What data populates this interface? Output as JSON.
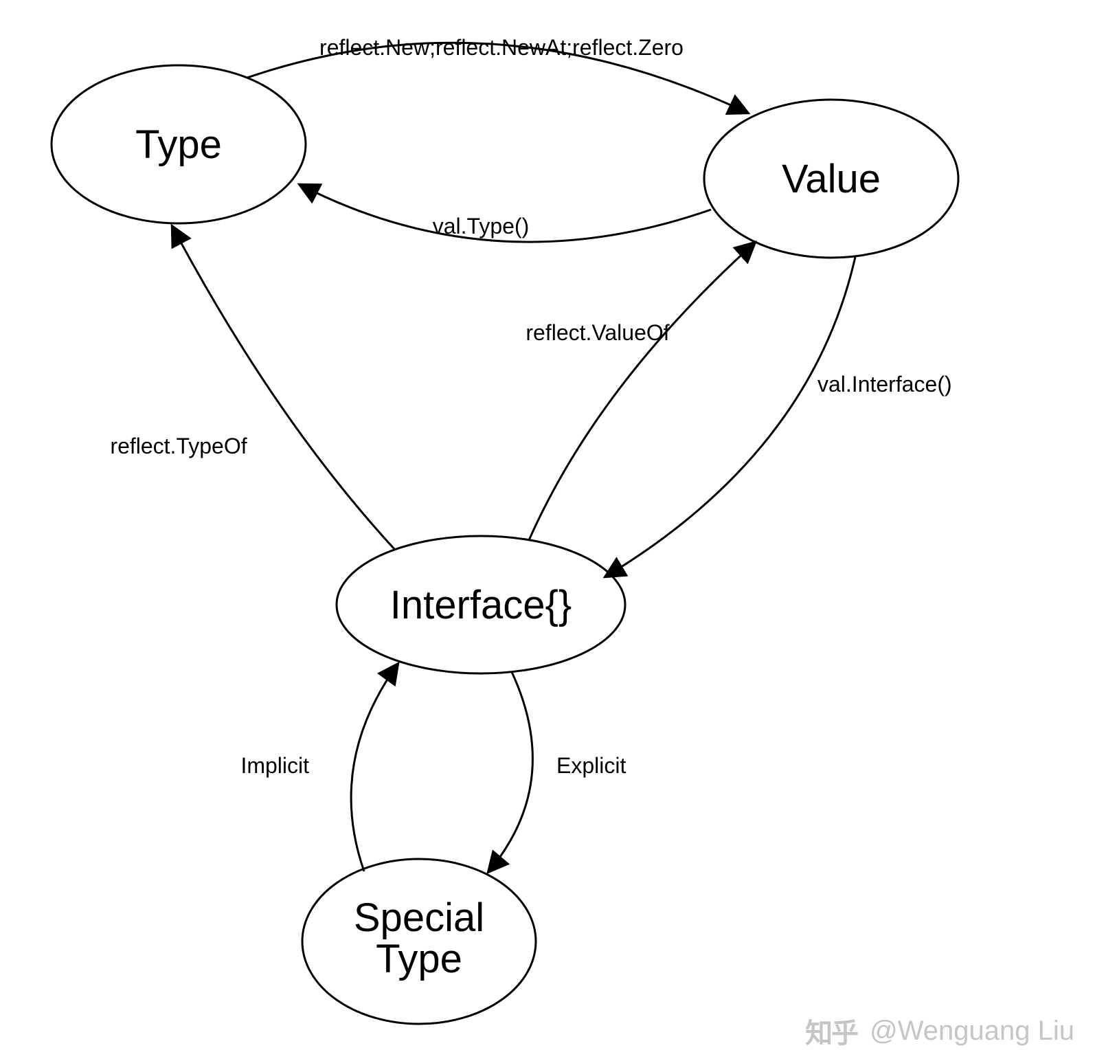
{
  "nodes": {
    "type": {
      "label": "Type"
    },
    "value": {
      "label": "Value"
    },
    "interface": {
      "label": "Interface{}"
    },
    "special": {
      "line1": "Special",
      "line2": "Type"
    }
  },
  "edges": {
    "type_to_value": {
      "label": "reflect.New;reflect.NewAt;reflect.Zero"
    },
    "value_to_type": {
      "label": "val.Type()"
    },
    "interface_to_value": {
      "label": "reflect.ValueOf"
    },
    "value_to_interface": {
      "label": "val.Interface()"
    },
    "interface_to_type": {
      "label": "reflect.TypeOf"
    },
    "special_to_interface": {
      "label": "Implicit"
    },
    "interface_to_special": {
      "label": "Explicit"
    }
  },
  "watermark": {
    "logo": "知乎",
    "author": "@Wenguang Liu"
  }
}
